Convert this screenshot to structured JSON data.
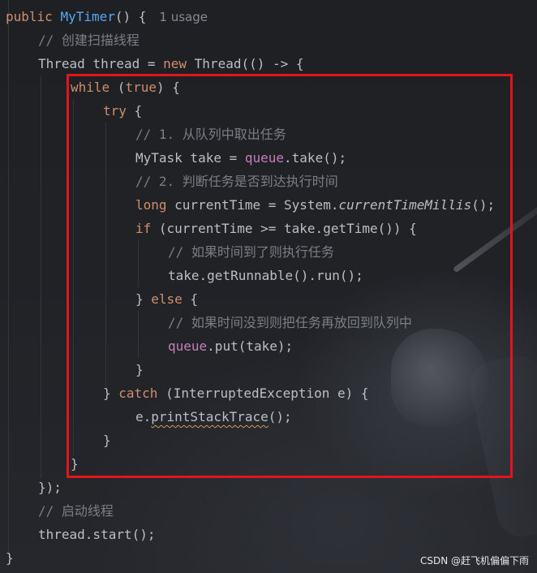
{
  "editor": {
    "usage_hint": "1 usage",
    "lines": {
      "l1": {
        "kw": "public",
        "name": "MyTimer",
        "rest": "() {"
      },
      "l2": {
        "comment": "// 创建扫描线程"
      },
      "l3": {
        "a": "Thread thread = ",
        "kw": "new",
        "b": " Thread(() -> {"
      },
      "l4": {
        "kw1": "while",
        "a": " (",
        "kw2": "true",
        "b": ") {"
      },
      "l5": {
        "kw": "try",
        "a": " {"
      },
      "l6": {
        "comment": "// 1. 从队列中取出任务"
      },
      "l7": {
        "a": "MyTask take = ",
        "field": "queue",
        "b": ".take();"
      },
      "l8": {
        "comment": "// 2. 判断任务是否到达执行时间"
      },
      "l9": {
        "kw": "long",
        "a": " currentTime = System.",
        "method": "currentTimeMillis",
        "b": "();"
      },
      "l10": {
        "kw": "if",
        "a": " (currentTime >= take.getTime()) {"
      },
      "l11": {
        "comment": "// 如果时间到了则执行任务"
      },
      "l12": {
        "a": "take.getRunnable().run();"
      },
      "l13": {
        "a": "} ",
        "kw": "else",
        "b": " {"
      },
      "l14": {
        "comment": "// 如果时间没到则把任务再放回到队列中"
      },
      "l15": {
        "field": "queue",
        "a": ".put(take);"
      },
      "l16": {
        "a": "}"
      },
      "l17": {
        "a": "} ",
        "kw": "catch",
        "b": " (InterruptedException e) {"
      },
      "l18": {
        "a": "e.",
        "method": "printStackTrace",
        "b": "();"
      },
      "l19": {
        "a": "}"
      },
      "l20": {
        "a": "}"
      },
      "l21": {
        "a": "});"
      },
      "l22": {
        "comment": "// 启动线程"
      },
      "l23": {
        "a": "thread.start();"
      },
      "l24": {
        "a": "}"
      }
    }
  },
  "colors": {
    "background": "#1e1f22",
    "keyword": "#cf8e6d",
    "function_name": "#56a8f5",
    "comment": "#7a7e85",
    "field": "#c77dbb",
    "highlight_box": "#e5131b"
  },
  "watermark": "CSDN @赶飞机偏偏下雨"
}
